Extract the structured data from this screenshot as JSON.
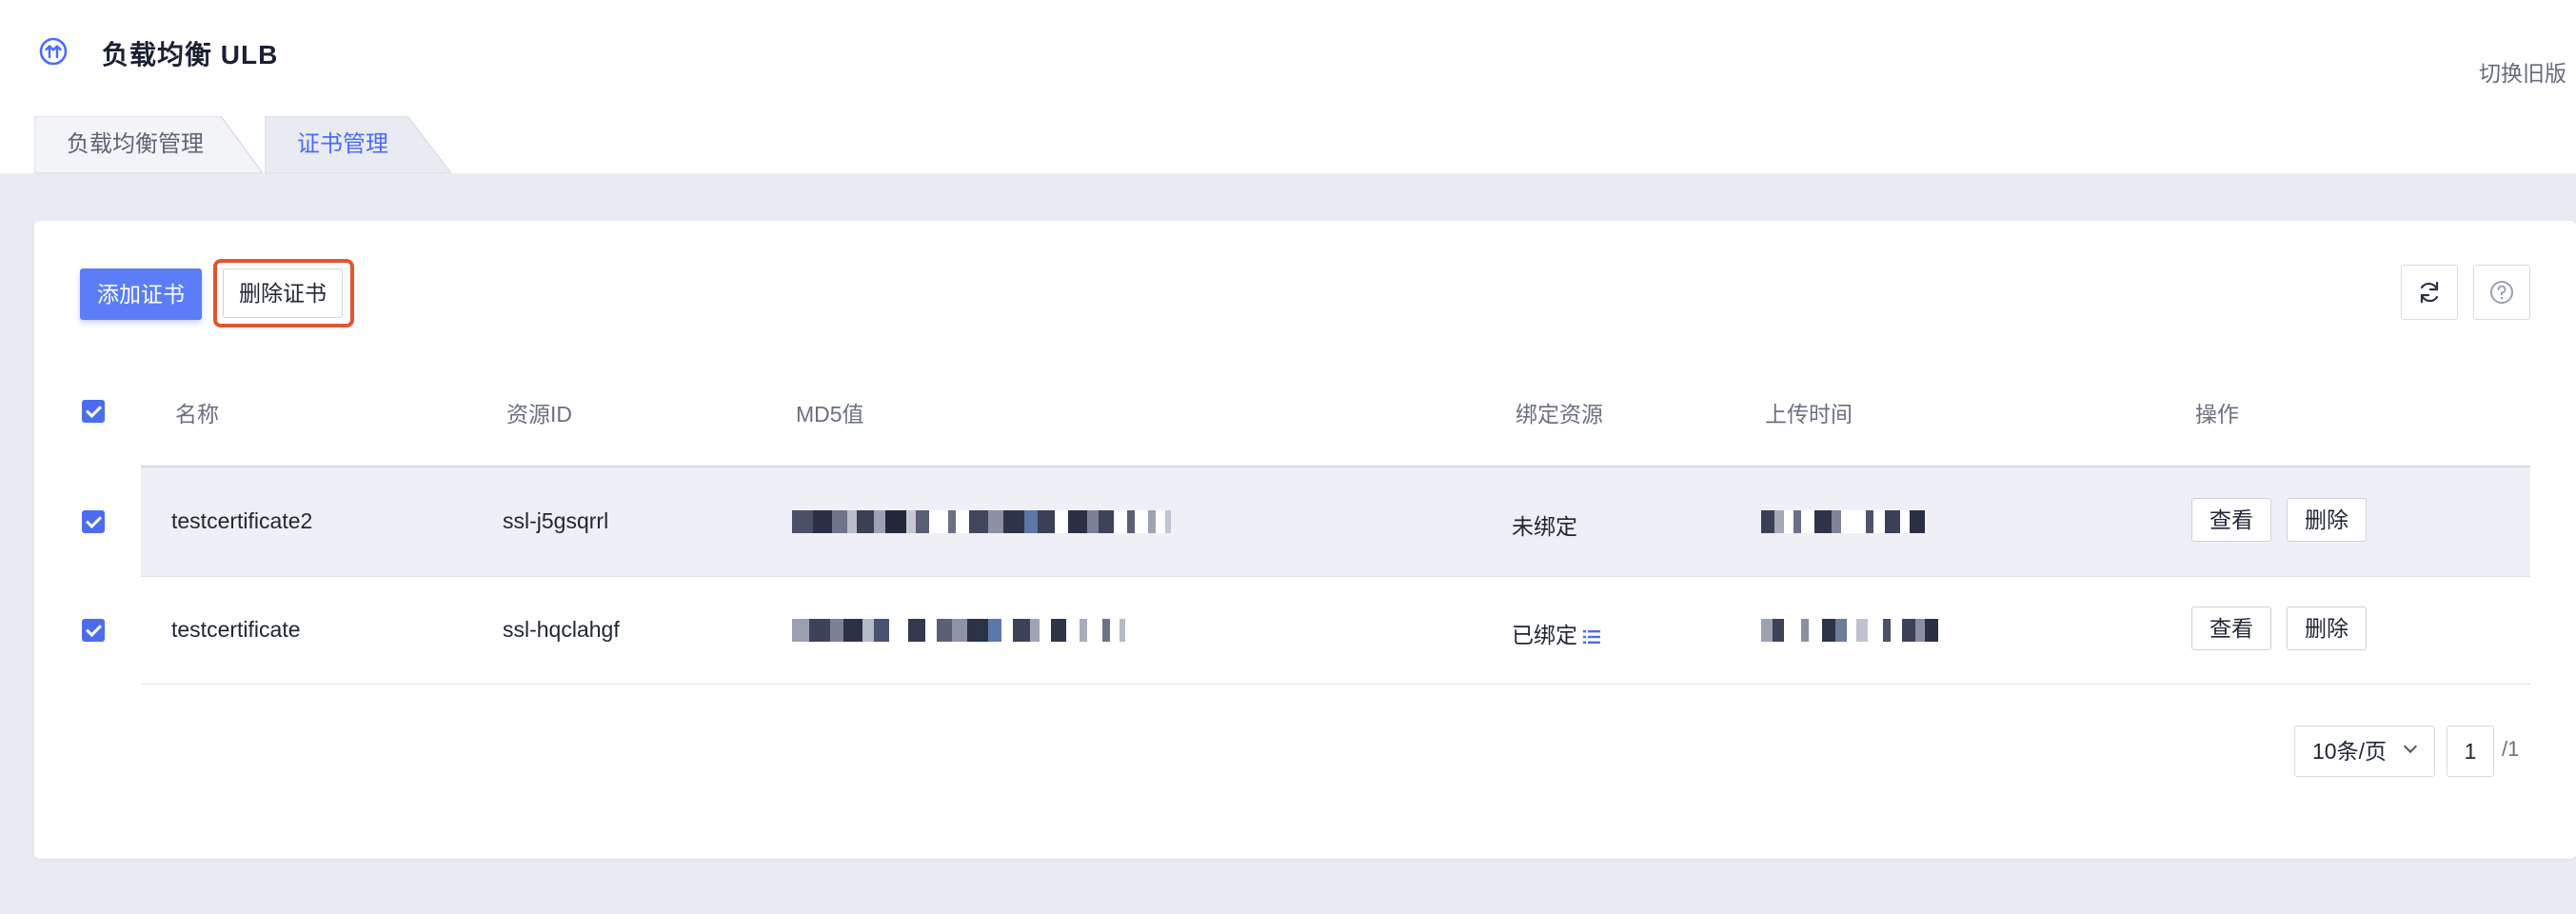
{
  "header": {
    "title": "负载均衡 ULB",
    "switch_old": "切换旧版",
    "tabs": [
      {
        "label": "负载均衡管理",
        "active": false
      },
      {
        "label": "证书管理",
        "active": true
      }
    ]
  },
  "toolbar": {
    "add_label": "添加证书",
    "delete_label": "删除证书",
    "refresh_icon": "refresh-icon",
    "help_icon": "help-icon"
  },
  "table": {
    "columns": [
      "名称",
      "资源ID",
      "MD5值",
      "绑定资源",
      "上传时间",
      "操作"
    ],
    "header_checked": true,
    "rows": [
      {
        "checked": true,
        "name": "testcertificate2",
        "resource_id": "ssl-j5gsqrrl",
        "binding": "未绑定",
        "has_binding_icon": false,
        "actions": [
          "查看",
          "删除"
        ]
      },
      {
        "checked": true,
        "name": "testcertificate",
        "resource_id": "ssl-hqclahgf",
        "binding": "已绑定",
        "has_binding_icon": true,
        "actions": [
          "查看",
          "删除"
        ]
      }
    ]
  },
  "pagination": {
    "page_size": "10条/页",
    "current_page": "1",
    "total": "/1"
  },
  "colors": {
    "primary": "#5b7df5",
    "highlight_frame": "#e4552c",
    "page_bg": "#e9ebf2"
  }
}
